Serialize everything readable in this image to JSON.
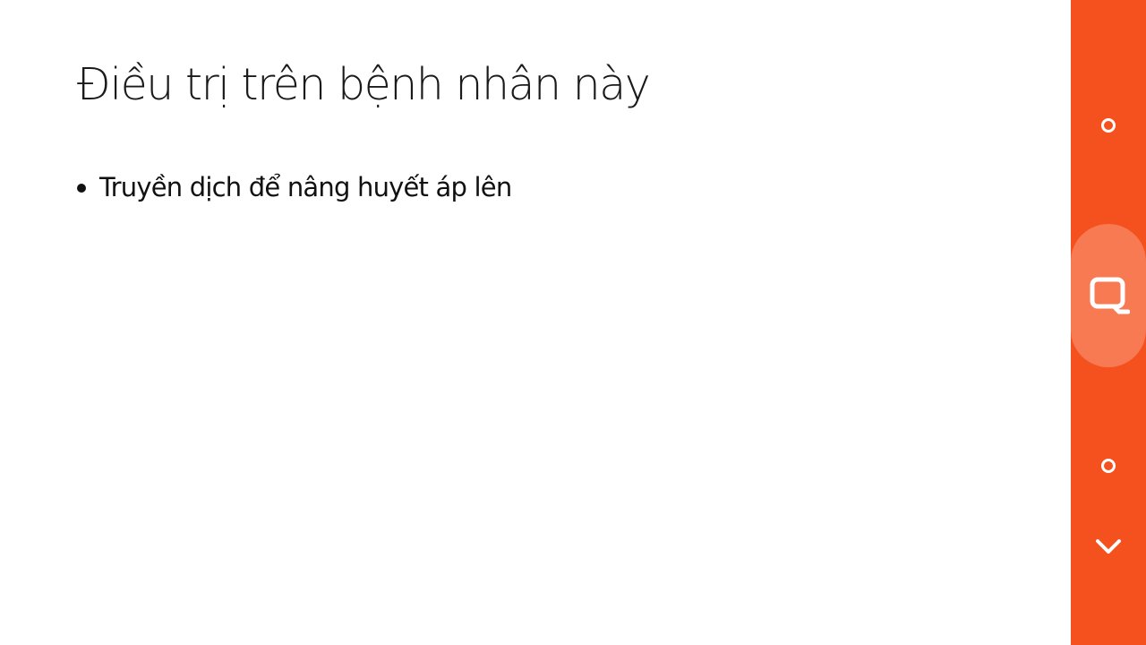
{
  "slide": {
    "title": "Điều trị trên bệnh nhân này",
    "bullets": [
      "Truyền dịch để nâng huyết áp lên"
    ]
  },
  "side_bar": {
    "background_color": "#f4511e",
    "highlight_color": "#f77a52",
    "icon_color": "#ffffff",
    "buttons": [
      {
        "name": "circle-top-button",
        "icon": "circle-icon"
      },
      {
        "name": "screenshot-button",
        "icon": "screenshot-frame-icon"
      },
      {
        "name": "circle-bottom-button",
        "icon": "circle-icon"
      },
      {
        "name": "collapse-button",
        "icon": "chevron-down-icon"
      }
    ]
  }
}
